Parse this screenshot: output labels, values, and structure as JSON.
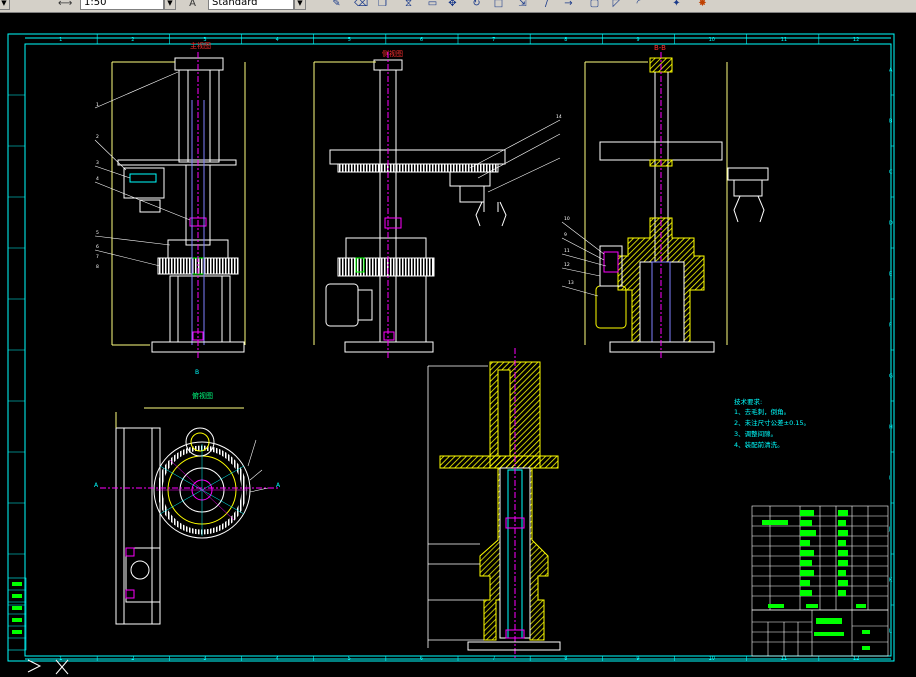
{
  "toolbar": {
    "scale_value": "1:50",
    "text_style_value": "Standard",
    "icons": [
      "dim-style-icon",
      "match-prop-icon",
      "erase-icon",
      "copy-icon",
      "mirror-icon",
      "offset-icon",
      "array-icon",
      "move-icon",
      "rotate-icon",
      "scale-icon",
      "stretch-icon",
      "trim-icon",
      "extend-icon",
      "break-icon",
      "chamfer-icon",
      "fillet-icon",
      "explode-icon"
    ]
  },
  "drawing": {
    "grid_columns": [
      "1",
      "2",
      "3",
      "4",
      "5",
      "6",
      "7",
      "8",
      "9",
      "10",
      "11",
      "12"
    ],
    "grid_rows": [
      "A",
      "B",
      "C",
      "D",
      "E",
      "F",
      "G",
      "H",
      "I",
      "J",
      "K",
      "L"
    ],
    "view_titles": {
      "front": "主视图",
      "left": "侧视图",
      "section": "B-B",
      "top": "俯视图"
    },
    "section_marks": [
      "B",
      "A",
      "A"
    ],
    "part_labels_front": [
      "1",
      "2",
      "3",
      "4",
      "5",
      "6",
      "7",
      "8"
    ],
    "part_labels_right": [
      "10",
      "9",
      "11",
      "12",
      "13",
      "14"
    ],
    "tech_requirements": {
      "heading": "技术要求:",
      "items": [
        "1、去毛刺，倒角。",
        "2、未注尺寸公差±0.15。",
        "3、调整间隙。",
        "4、装配前清洗。"
      ]
    }
  },
  "colors": {
    "frame": "#00ffff",
    "geometry": "#ffffff",
    "hatch": "#ffff00",
    "green": "#00ff00",
    "magenta": "#ff00ff",
    "red": "#ff0000",
    "dim": "#ffff80"
  }
}
